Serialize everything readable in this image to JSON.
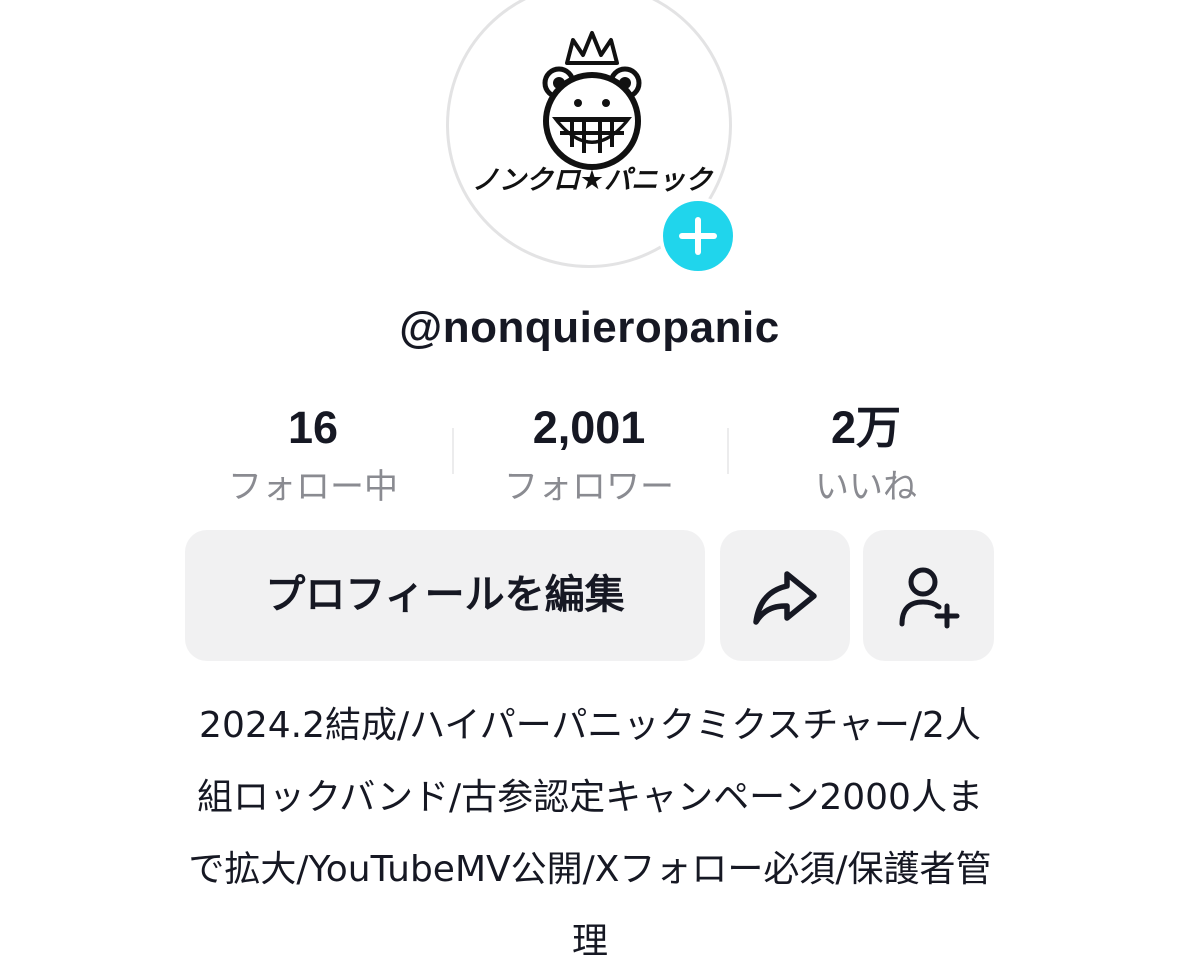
{
  "profile": {
    "username": "@nonquieropanic",
    "avatar_logo_text": "ノンクロ★パニック",
    "avatar_icon": "band-logo-crowned-monkey",
    "add_icon": "plus-icon"
  },
  "stats": {
    "following": {
      "value": "16",
      "label": "フォロー中"
    },
    "followers": {
      "value": "2,001",
      "label": "フォロワー"
    },
    "likes": {
      "value": "2万",
      "label": "いいね"
    }
  },
  "actions": {
    "edit_profile_label": "プロフィールを編集",
    "share_icon": "share-arrow-icon",
    "add_friend_icon": "add-user-icon"
  },
  "bio": {
    "lines": [
      "2024.2結成/ハイパーパニックミクスチャー/2人",
      "組ロックバンド/古参認定キャンペーン2000人ま",
      "で拡大/YouTubeMV公開/Xフォロー必須/保護者管",
      "理"
    ]
  },
  "colors": {
    "accent": "#20d5ec",
    "button_bg": "#f1f1f2",
    "text_primary": "#161823",
    "text_secondary": "#8a8b91"
  }
}
